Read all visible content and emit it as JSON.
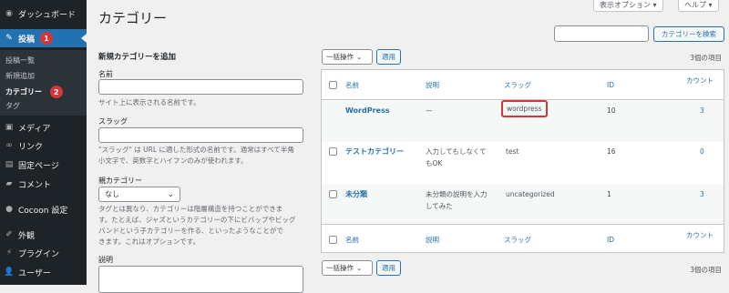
{
  "sidebar": {
    "dashboard": "ダッシュボード",
    "posts": "投稿",
    "posts_badge": "1",
    "sub": {
      "all": "投稿一覧",
      "new": "新規追加",
      "categories": "カテゴリー",
      "categories_badge": "2",
      "tags": "タグ"
    },
    "media": "メディア",
    "links": "リンク",
    "pages": "固定ページ",
    "comments": "コメント",
    "cocoon": "Cocoon 設定",
    "appearance": "外観",
    "plugins": "プラグイン",
    "users": "ユーザー"
  },
  "header": {
    "title": "カテゴリー",
    "screen_options": "表示オプション ▾",
    "help": "ヘルプ ▾",
    "search_button": "カテゴリーを検索"
  },
  "form": {
    "title": "新規カテゴリーを追加",
    "name_label": "名前",
    "name_help": "サイト上に表示される名前です。",
    "slug_label": "スラッグ",
    "slug_help_1": "\"スラッグ\" は URL に適した形式の名前です。通常はすべて半角",
    "slug_help_2": "小文字で、英数字とハイフンのみが使われます。",
    "parent_label": "親カテゴリー",
    "parent_value": "なし",
    "parent_help_1": "タグとは異なり、カテゴリーは階層構造を持つことができま",
    "parent_help_2": "す。たとえば、ジャズというカテゴリーの下にビバップやビッグ",
    "parent_help_3": "バンドという子カテゴリーを作る、といったようなことがで",
    "parent_help_4": "きます。これはオプションです。",
    "desc_label": "説明"
  },
  "list": {
    "bulk_label": "一括操作",
    "apply_label": "適用",
    "count_label": "3個の項目",
    "columns": {
      "name": "名前",
      "description": "説明",
      "slug": "スラッグ",
      "id": "ID",
      "count": "カウント"
    },
    "rows": [
      {
        "name": "WordPress",
        "description": "—",
        "slug": "wordpress",
        "id": "10",
        "count": "3"
      },
      {
        "name": "テストカテゴリー",
        "description_1": "入力してもしなくて",
        "description_2": "もOK",
        "slug": "test",
        "id": "16",
        "count": "0"
      },
      {
        "name": "未分類",
        "description_1": "未分類の説明を入力",
        "description_2": "してみた",
        "slug": "uncategorized",
        "id": "1",
        "count": "3"
      }
    ]
  },
  "colors": {
    "sidebar_bg": "#1d2327",
    "accent": "#2271b1",
    "badge": "#d63638",
    "highlight": "#d63638"
  }
}
